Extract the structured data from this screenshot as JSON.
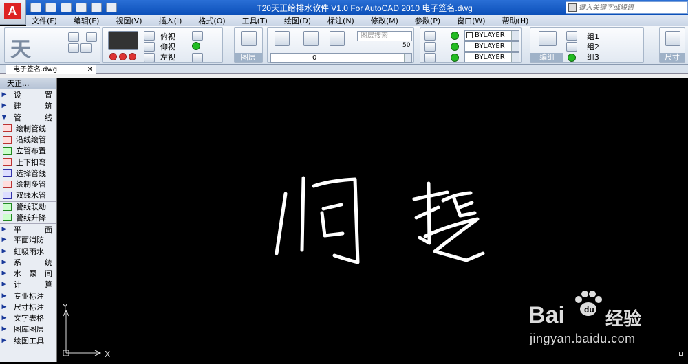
{
  "window": {
    "title": "T20天正给排水软件 V1.0 For AutoCAD 2010      电子签名.dwg",
    "search_placeholder": "键入关键字或短语"
  },
  "menu": [
    "文件(F)",
    "编辑(E)",
    "视图(V)",
    "插入(I)",
    "格式(O)",
    "工具(T)",
    "绘图(D)",
    "标注(N)",
    "修改(M)",
    "参数(P)",
    "窗口(W)",
    "帮助(H)"
  ],
  "ribbon": {
    "views": [
      "俯视",
      "仰视",
      "左视"
    ],
    "layers_label": "图层",
    "layer_search_placeholder": "图层搜索",
    "layer_slider_value": "50",
    "current_layer": "0",
    "properties": [
      "BYLAYER",
      "BYLAYER",
      "BYLAYER"
    ],
    "groups": [
      "组1",
      "组2",
      "组3"
    ],
    "group_label": "编组",
    "dimension_label": "尺寸"
  },
  "document_tab": "电子签名.dwg",
  "sidebar": {
    "header": "天正...",
    "items": [
      {
        "label": "设置",
        "type": "cat",
        "arrow": "▶"
      },
      {
        "label": "建筑",
        "type": "cat",
        "arrow": "▶"
      },
      {
        "label": "管线",
        "type": "cat",
        "arrow": "▼"
      },
      {
        "label": "绘制管线",
        "type": "tool",
        "icon": "r"
      },
      {
        "label": "沿线绘管",
        "type": "tool",
        "icon": "r"
      },
      {
        "label": "立管布置",
        "type": "tool",
        "icon": "g"
      },
      {
        "label": "上下扣弯",
        "type": "tool",
        "icon": "r"
      },
      {
        "label": "选择管线",
        "type": "tool",
        "icon": "b"
      },
      {
        "label": "绘制多管",
        "type": "tool",
        "icon": "r"
      },
      {
        "label": "双线水管",
        "type": "tool",
        "icon": "b"
      },
      {
        "label": "管线联动",
        "type": "tool",
        "icon": "g",
        "divider": true
      },
      {
        "label": "管线升降",
        "type": "tool",
        "icon": "g"
      },
      {
        "label": "平面",
        "type": "cat",
        "arrow": "▶",
        "divider": true
      },
      {
        "label": "平面消防",
        "type": "cat2",
        "arrow": "▶"
      },
      {
        "label": "虹吸雨水",
        "type": "cat2",
        "arrow": "▶"
      },
      {
        "label": "系统",
        "type": "cat",
        "arrow": "▶"
      },
      {
        "label": "水泵间",
        "type": "cat",
        "arrow": "▶"
      },
      {
        "label": "计算",
        "type": "cat",
        "arrow": "▶"
      },
      {
        "label": "专业标注",
        "type": "cat2",
        "arrow": "▶",
        "divider": true
      },
      {
        "label": "尺寸标注",
        "type": "cat2",
        "arrow": "▶"
      },
      {
        "label": "文字表格",
        "type": "cat2",
        "arrow": "▶"
      },
      {
        "label": "图库图层",
        "type": "cat2",
        "arrow": "▶"
      },
      {
        "label": "绘图工具",
        "type": "cat2",
        "arrow": "▶"
      }
    ]
  },
  "canvas": {
    "signature": "闫哲",
    "axis_x": "X",
    "axis_y": "Y"
  },
  "watermark": {
    "logo": "Bai",
    "logo2": "经验",
    "url": "jingyan.baidu.com"
  }
}
